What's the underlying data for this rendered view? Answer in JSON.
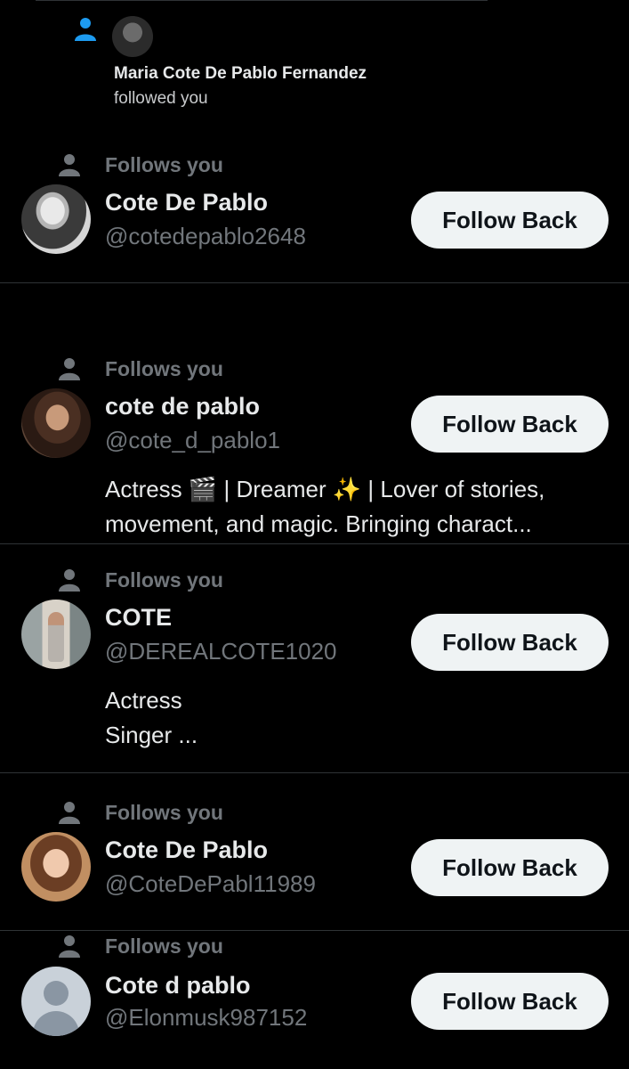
{
  "notification": {
    "name": "Maria Cote De Pablo Fernandez",
    "text": "followed you",
    "icon": "person-icon",
    "accent": "#1d9bf0"
  },
  "follows_label": "Follows you",
  "button_label": "Follow Back",
  "followers": [
    {
      "name": "Cote De Pablo",
      "handle": "@cotedepablo2648",
      "bio": []
    },
    {
      "name": "cote de pablo",
      "handle": "@cote_d_pablo1",
      "bio": [
        "Actress 🎬 | Dreamer ✨ | Lover of stories,",
        "movement, and magic. Bringing charact..."
      ]
    },
    {
      "name": "COTE",
      "handle": "@DEREALCOTE1020",
      "bio": [
        "Actress",
        "Singer ..."
      ]
    },
    {
      "name": "Cote De Pablo",
      "handle": "@CoteDePabl11989",
      "bio": []
    },
    {
      "name": "Cote d pablo",
      "handle": "@Elonmusk987152",
      "bio": []
    }
  ],
  "colors": {
    "background": "#000000",
    "text_primary": "#e7e9ea",
    "text_secondary": "#71767b",
    "button_bg": "#eff3f4",
    "button_text": "#0f1419",
    "divider": "#2f3336"
  }
}
